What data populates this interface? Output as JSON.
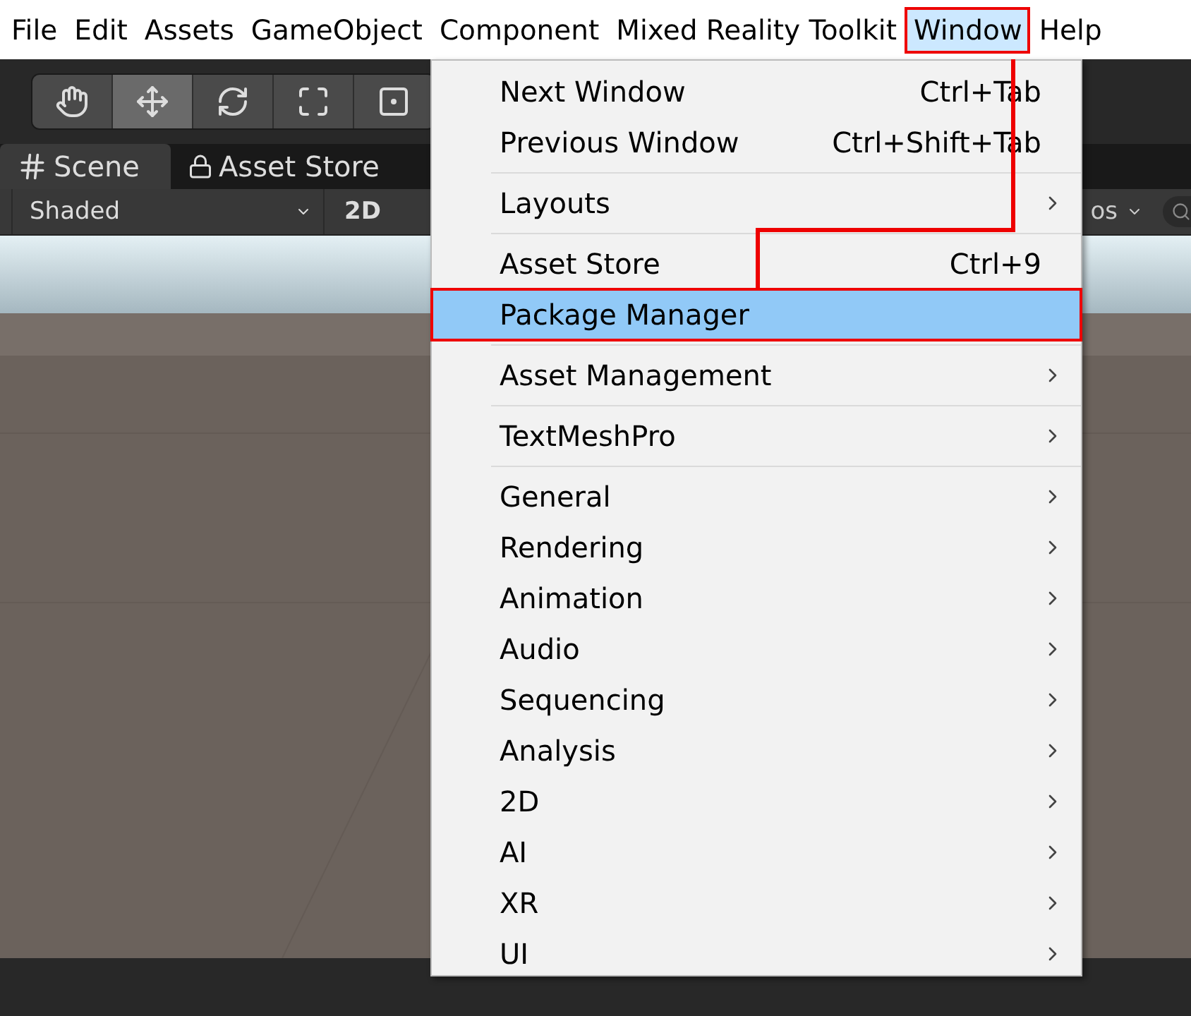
{
  "menu_bar": [
    {
      "label": "File",
      "selected": false
    },
    {
      "label": "Edit",
      "selected": false
    },
    {
      "label": "Assets",
      "selected": false
    },
    {
      "label": "GameObject",
      "selected": false
    },
    {
      "label": "Component",
      "selected": false
    },
    {
      "label": "Mixed Reality Toolkit",
      "selected": false
    },
    {
      "label": "Window",
      "selected": true
    },
    {
      "label": "Help",
      "selected": false
    }
  ],
  "tools": [
    {
      "kind": "hand",
      "selected": false
    },
    {
      "kind": "move",
      "selected": true
    },
    {
      "kind": "rotate",
      "selected": false
    },
    {
      "kind": "scale",
      "selected": false
    },
    {
      "kind": "rect",
      "selected": false
    }
  ],
  "tabs": [
    {
      "kind": "scene",
      "label": "Scene",
      "selected": true
    },
    {
      "kind": "store",
      "label": "Asset Store",
      "selected": false
    }
  ],
  "scene_toolbar": {
    "shading": "Shaded",
    "mode": "2D",
    "gizmos": "os"
  },
  "window_menu": [
    [
      {
        "label": "Next Window",
        "shortcut": "Ctrl+Tab",
        "submenu": false,
        "selected": false
      },
      {
        "label": "Previous Window",
        "shortcut": "Ctrl+Shift+Tab",
        "submenu": false,
        "selected": false
      }
    ],
    [
      {
        "label": "Layouts",
        "submenu": true,
        "selected": false
      }
    ],
    [
      {
        "label": "Asset Store",
        "shortcut": "Ctrl+9",
        "submenu": false,
        "selected": false
      },
      {
        "label": "Package Manager",
        "submenu": false,
        "selected": true
      }
    ],
    [
      {
        "label": "Asset Management",
        "submenu": true,
        "selected": false
      }
    ],
    [
      {
        "label": "TextMeshPro",
        "submenu": true,
        "selected": false
      }
    ],
    [
      {
        "label": "General",
        "submenu": true,
        "selected": false
      },
      {
        "label": "Rendering",
        "submenu": true,
        "selected": false
      },
      {
        "label": "Animation",
        "submenu": true,
        "selected": false
      },
      {
        "label": "Audio",
        "submenu": true,
        "selected": false
      },
      {
        "label": "Sequencing",
        "submenu": true,
        "selected": false
      },
      {
        "label": "Analysis",
        "submenu": true,
        "selected": false
      },
      {
        "label": "2D",
        "submenu": true,
        "selected": false
      },
      {
        "label": "AI",
        "submenu": true,
        "selected": false
      },
      {
        "label": "XR",
        "submenu": true,
        "selected": false
      },
      {
        "label": "UI",
        "submenu": true,
        "selected": false
      }
    ]
  ]
}
